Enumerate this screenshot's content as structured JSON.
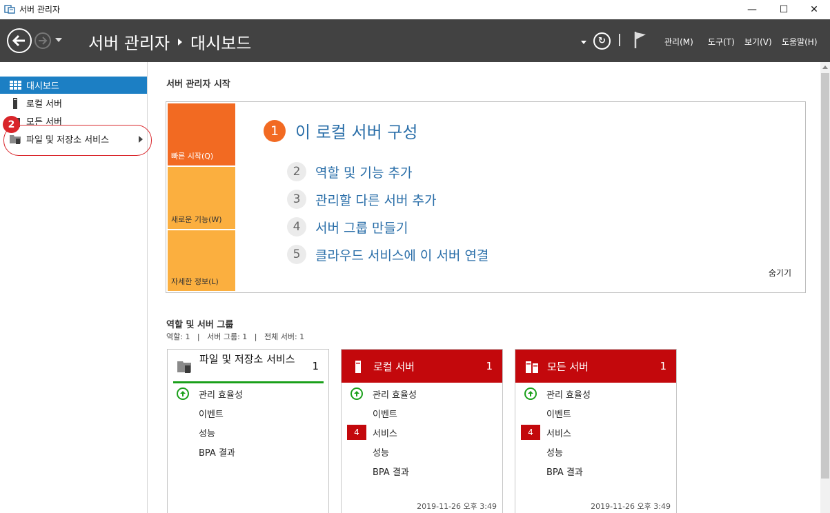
{
  "window": {
    "title": "서버 관리자",
    "minimize_glyph": "—",
    "maximize_glyph": "☐",
    "close_glyph": "✕"
  },
  "header": {
    "breadcrumb_root": "서버 관리자",
    "breadcrumb_page": "대시보드",
    "menus": [
      "관리(M)",
      "도구(T)",
      "보기(V)",
      "도움말(H)"
    ]
  },
  "sidebar": {
    "items": [
      {
        "label": "대시보드",
        "icon": "dashboard-icon",
        "active": true
      },
      {
        "label": "로컬 서버",
        "icon": "server-icon"
      },
      {
        "label": "모든 서버",
        "icon": "servers-icon"
      },
      {
        "label": "파일 및 저장소 서비스",
        "icon": "file-storage-icon",
        "has_arrow": true
      }
    ],
    "callout_number": "2"
  },
  "main": {
    "title": "서버 관리자 시작",
    "quickstart": {
      "tabs": [
        "빠른 시작(Q)",
        "새로운 기능(W)",
        "자세한 정보(L)"
      ],
      "tab_colors": [
        "#f26a22",
        "#fbaf3f",
        "#fbaf3f"
      ],
      "steps": [
        {
          "num": "1",
          "text": "이 로컬 서버 구성"
        },
        {
          "num": "2",
          "text": "역할 및 기능 추가"
        },
        {
          "num": "3",
          "text": "관리할 다른 서버 추가"
        },
        {
          "num": "4",
          "text": "서버 그룹 만들기"
        },
        {
          "num": "5",
          "text": "클라우드 서비스에 이 서버 연결"
        }
      ],
      "hide": "숨기기"
    },
    "roles": {
      "title": "역할 및 서버 그룹",
      "subtitle": "역할: 1   |   서버 그룹: 1   |   전체 서버: 1",
      "cards": [
        {
          "name": "파일 및 저장소 서비스",
          "count": "1",
          "status": "ok",
          "rows": [
            "관리 효율성",
            "이벤트",
            "성능",
            "BPA 결과"
          ],
          "time": ""
        },
        {
          "name": "로컬 서버",
          "count": "1",
          "status": "alert",
          "rows": [
            "관리 효율성",
            "이벤트",
            "서비스",
            "성능",
            "BPA 결과"
          ],
          "service_badge": "4",
          "time": "2019-11-26 오후 3:49"
        },
        {
          "name": "모든 서버",
          "count": "1",
          "status": "alert",
          "rows": [
            "관리 효율성",
            "이벤트",
            "서비스",
            "성능",
            "BPA 결과"
          ],
          "service_badge": "4",
          "time": "2019-11-26 오후 3:49"
        }
      ]
    }
  },
  "colors": {
    "header_bg": "#424242",
    "accent_blue": "#1c7fc4",
    "alert_red": "#c3080c",
    "ok_green": "#1aa01a",
    "callout_red": "#d9252a"
  }
}
